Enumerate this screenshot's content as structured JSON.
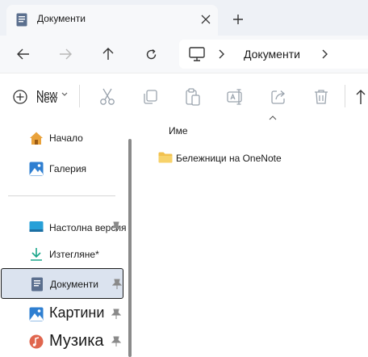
{
  "tab": {
    "title": "Документи",
    "icon": "documents-icon"
  },
  "navigation": {
    "back": "arrow-left-icon",
    "forward": "arrow-right-icon",
    "up": "arrow-up-icon",
    "refresh": "refresh-icon"
  },
  "address_bar": {
    "root_icon": "this-pc-icon",
    "current_segment": "Документи"
  },
  "command_bar": {
    "new_label_line1": "New",
    "new_label_line2": "New",
    "actions": [
      "cut-icon",
      "copy-icon",
      "paste-icon",
      "rename-icon",
      "share-icon",
      "delete-icon",
      "sort-icon"
    ]
  },
  "sidebar": {
    "items": [
      {
        "label": "Начало",
        "icon": "home-icon"
      },
      {
        "label": "Галерия",
        "icon": "gallery-icon"
      },
      {
        "label": "Настолна версия",
        "icon": "desktop-icon",
        "pinned": true
      },
      {
        "label": "Изтегляне*",
        "icon": "download-icon",
        "pinned": false
      },
      {
        "label": "Документи",
        "icon": "documents-icon",
        "pinned": true,
        "selected": true
      },
      {
        "label": "Картини",
        "icon": "pictures-icon",
        "pinned": true
      },
      {
        "label": "Музика",
        "icon": "music-icon",
        "pinned": true
      }
    ]
  },
  "content": {
    "column_header": "Име",
    "files": [
      {
        "name": "Бележници на OneNote",
        "type": "folder"
      }
    ]
  },
  "colors": {
    "tabstrip_bg": "#eef1f6",
    "toolbar_bg": "#f7f8fa",
    "selected_bg": "#dbe3ef",
    "folder": "#f2c14e",
    "accent_blue": "#1e73c8"
  }
}
